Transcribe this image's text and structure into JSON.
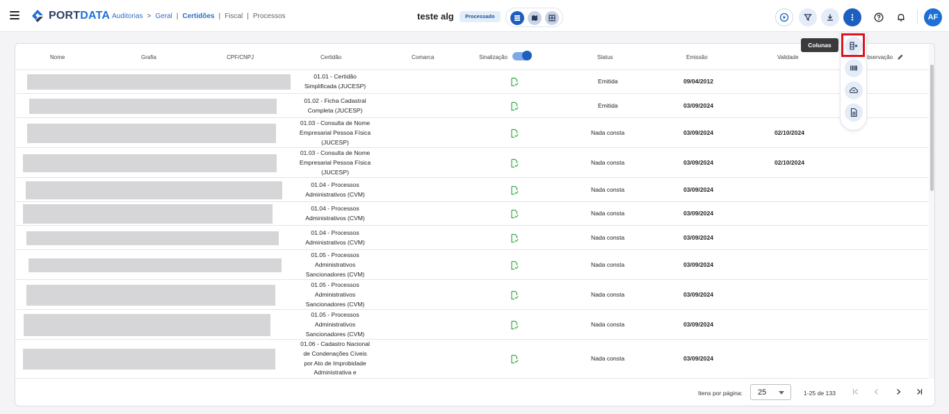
{
  "brand": {
    "name_part1": "PORT",
    "name_part2": "DATA"
  },
  "breadcrumb": [
    {
      "label": "Auditorias",
      "style": "link"
    },
    {
      "label": ">",
      "style": "sep"
    },
    {
      "label": "Geral",
      "style": "link"
    },
    {
      "label": "|",
      "style": "sep"
    },
    {
      "label": "Certidões",
      "style": "active"
    },
    {
      "label": "|",
      "style": "sep"
    },
    {
      "label": "Fiscal",
      "style": "muted"
    },
    {
      "label": "|",
      "style": "sep"
    },
    {
      "label": "Processos",
      "style": "muted"
    }
  ],
  "header": {
    "title": "teste alg",
    "status_badge": "Processado",
    "avatar_initials": "AF"
  },
  "icons": {
    "menu": "hamburger-icon",
    "views": [
      "list-view-icon",
      "map-view-icon",
      "grid-view-icon"
    ],
    "actions": [
      "play-icon",
      "filter-icon",
      "download-icon",
      "more-vertical-icon",
      "help-icon",
      "bell-icon"
    ],
    "fab": [
      "columns-icon",
      "barcode-icon",
      "cloud-upload-icon",
      "document-icon"
    ]
  },
  "colors": {
    "accent": "#1d5fbf",
    "signal_green": "#2eaa3c",
    "highlight_red": "#e0101c"
  },
  "table": {
    "columns": [
      "Nome",
      "Grafia",
      "CPF/CNPJ",
      "Certidão",
      "Comarca",
      "Sinalização",
      "Status",
      "Emissão",
      "Validade",
      "Observação"
    ],
    "signal_toggle_on": true,
    "rows": [
      {
        "certidao": [
          "01.01 - Certidão",
          "Simplificada (JUCESP)"
        ],
        "status": "Emitida",
        "emissao": "09/04/2012",
        "validade": ""
      },
      {
        "certidao": [
          "01.02 - Ficha Cadastral",
          "Completa (JUCESP)"
        ],
        "status": "Emitida",
        "emissao": "03/09/2024",
        "validade": ""
      },
      {
        "certidao": [
          "01.03 - Consulta de Nome",
          "Empresarial Pessoa Física",
          "(JUCESP)"
        ],
        "status": "Nada consta",
        "emissao": "03/09/2024",
        "validade": "02/10/2024"
      },
      {
        "certidao": [
          "01.03 - Consulta de Nome",
          "Empresarial Pessoa Física",
          "(JUCESP)"
        ],
        "status": "Nada consta",
        "emissao": "03/09/2024",
        "validade": "02/10/2024"
      },
      {
        "certidao": [
          "01.04 - Processos",
          "Administrativos (CVM)"
        ],
        "status": "Nada consta",
        "emissao": "03/09/2024",
        "validade": ""
      },
      {
        "certidao": [
          "01.04 - Processos",
          "Administrativos (CVM)"
        ],
        "status": "Nada consta",
        "emissao": "03/09/2024",
        "validade": ""
      },
      {
        "certidao": [
          "01.04 - Processos",
          "Administrativos (CVM)"
        ],
        "status": "Nada consta",
        "emissao": "03/09/2024",
        "validade": ""
      },
      {
        "certidao": [
          "01.05 - Processos",
          "Administrativos",
          "Sancionadores (CVM)"
        ],
        "status": "Nada consta",
        "emissao": "03/09/2024",
        "validade": ""
      },
      {
        "certidao": [
          "01.05 - Processos",
          "Administrativos",
          "Sancionadores (CVM)"
        ],
        "status": "Nada consta",
        "emissao": "03/09/2024",
        "validade": ""
      },
      {
        "certidao": [
          "01.05 - Processos",
          "Administrativos",
          "Sancionadores (CVM)"
        ],
        "status": "Nada consta",
        "emissao": "03/09/2024",
        "validade": ""
      },
      {
        "certidao": [
          "01.06 - Cadastro Nacional",
          "de Condenações Cíveis",
          "por Ato de Improbidade",
          "Administrativa e"
        ],
        "status": "Nada consta",
        "emissao": "03/09/2024",
        "validade": ""
      }
    ]
  },
  "pagination": {
    "label": "Itens por página:",
    "page_size": "25",
    "range": "1-25 de 133"
  },
  "tooltip": "Colunas"
}
